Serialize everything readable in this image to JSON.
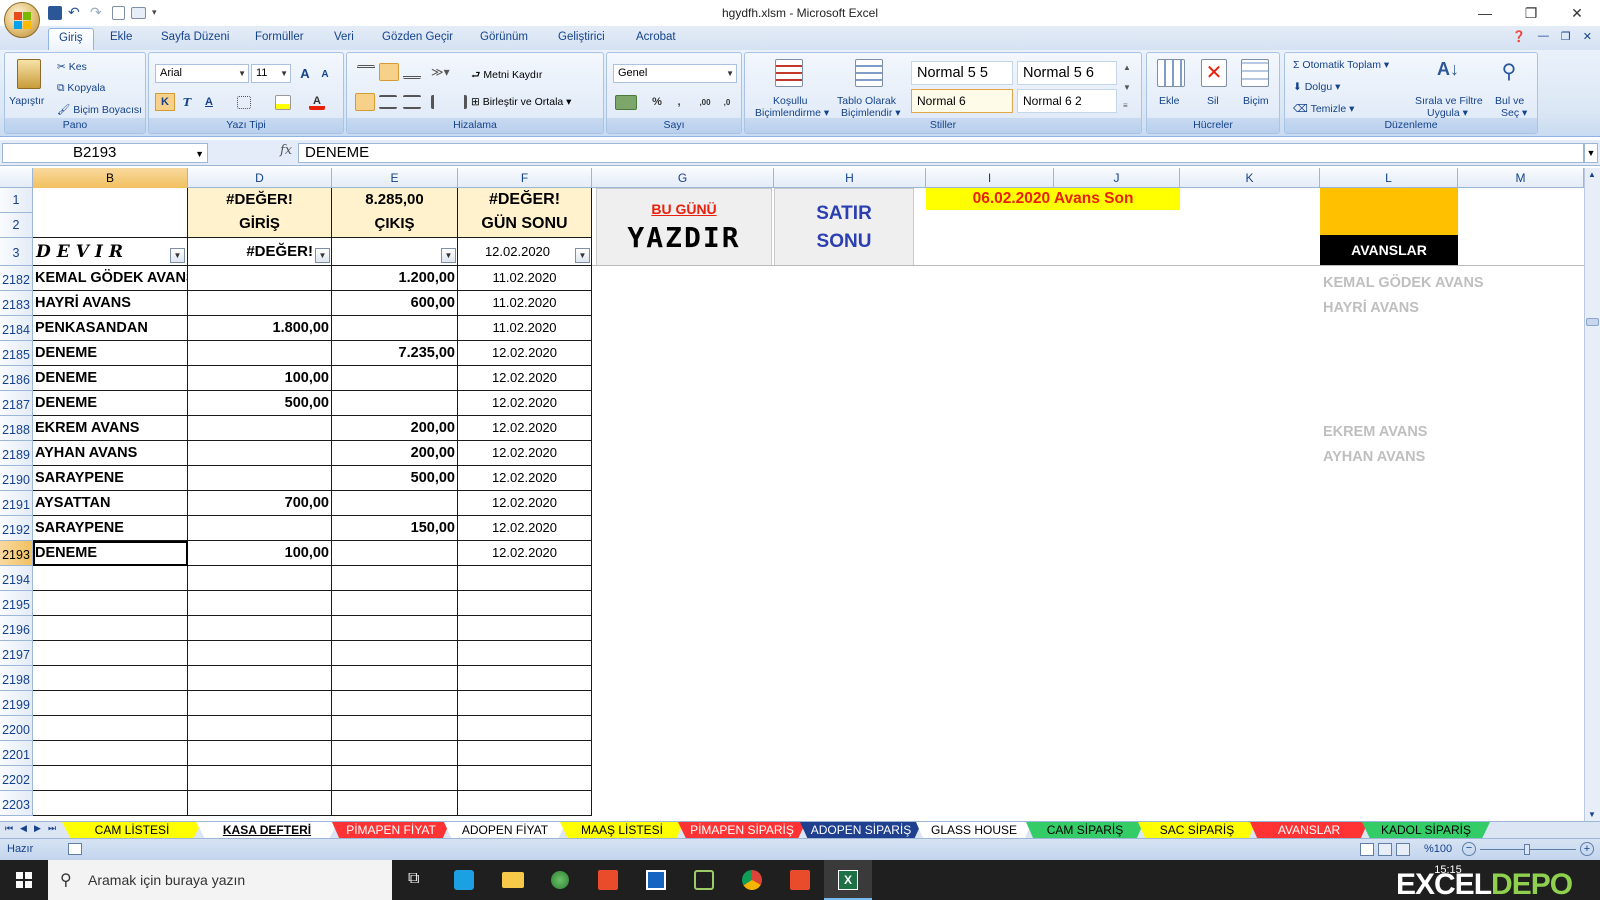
{
  "window": {
    "title": "hgydfh.xlsm - Microsoft Excel",
    "minimize": "—",
    "restore": "❐",
    "close": "✕"
  },
  "ribbon_tabs": [
    "Giriş",
    "Ekle",
    "Sayfa Düzeni",
    "Formüller",
    "Veri",
    "Gözden Geçir",
    "Görünüm",
    "Geliştirici",
    "Acrobat"
  ],
  "ribbon": {
    "pano": {
      "label": "Pano",
      "paste": "Yapıştır",
      "cut": "Kes",
      "copy": "Kopyala",
      "format_painter": "Biçim Boyacısı"
    },
    "font": {
      "label": "Yazı Tipi",
      "name": "Arial",
      "size": "11",
      "bold": "K",
      "italic": "T",
      "underline": "A"
    },
    "alignment": {
      "label": "Hizalama",
      "wrap": "Metni Kaydır",
      "merge": "Birleştir ve Ortala"
    },
    "number": {
      "label": "Sayı",
      "format": "Genel",
      "percent": "%",
      "comma": ","
    },
    "styles": {
      "label": "Stiller",
      "conditional": "Koşullu",
      "conditional2": "Biçimlendirme",
      "table": "Tablo Olarak",
      "table2": "Biçimlendir",
      "cells": [
        "Normal 5 5",
        "Normal 5 6",
        "Normal 6",
        "Normal 6 2"
      ]
    },
    "cells": {
      "label": "Hücreler",
      "insert": "Ekle",
      "delete": "Sil",
      "format": "Biçim"
    },
    "editing": {
      "label": "Düzenleme",
      "autosum": "Otomatik Toplam",
      "fill": "Dolgu",
      "clear": "Temizle",
      "sort": "Sırala ve Filtre",
      "sort2": "Uygula",
      "find": "Bul ve",
      "find2": "Seç"
    }
  },
  "formula_bar": {
    "name_box": "B2193",
    "fx": "fx",
    "value": "DENEME"
  },
  "columns": [
    "B",
    "D",
    "E",
    "F",
    "G",
    "H",
    "I",
    "J",
    "K",
    "L",
    "M"
  ],
  "header_rows": [
    "1",
    "2",
    "3"
  ],
  "header_cells": {
    "d1": "#DEĞER!",
    "d2": "GİRİŞ",
    "e1": "8.285,00",
    "e2": "ÇIKIŞ",
    "f1": "#DEĞER!",
    "f2": "GÜN SONU",
    "b3": "DEVIR",
    "d3": "#DEĞER!",
    "f3": "12.02.2020"
  },
  "buttons": {
    "bu_gunu": "BU GÜNÜ",
    "yazdir": "YAZDIR",
    "satir": "SATIR",
    "sonu": "SONU"
  },
  "avans_son": "06.02.2020  Avans Son",
  "avanslar": "AVANSLAR",
  "rows": [
    {
      "num": "2182",
      "b": "KEMAL GÖDEK AVANS",
      "d": "",
      "e": "1.200,00",
      "f": "11.02.2020"
    },
    {
      "num": "2183",
      "b": "HAYRİ AVANS",
      "d": "",
      "e": "600,00",
      "f": "11.02.2020"
    },
    {
      "num": "2184",
      "b": "PENKASANDAN",
      "d": "1.800,00",
      "e": "",
      "f": "11.02.2020"
    },
    {
      "num": "2185",
      "b": "DENEME",
      "d": "",
      "e": "7.235,00",
      "f": "12.02.2020"
    },
    {
      "num": "2186",
      "b": "DENEME",
      "d": "100,00",
      "e": "",
      "f": "12.02.2020"
    },
    {
      "num": "2187",
      "b": "DENEME",
      "d": "500,00",
      "e": "",
      "f": "12.02.2020"
    },
    {
      "num": "2188",
      "b": "EKREM AVANS",
      "d": "",
      "e": "200,00",
      "f": "12.02.2020"
    },
    {
      "num": "2189",
      "b": "AYHAN AVANS",
      "d": "",
      "e": "200,00",
      "f": "12.02.2020"
    },
    {
      "num": "2190",
      "b": "SARAYPENE",
      "d": "",
      "e": "500,00",
      "f": "12.02.2020"
    },
    {
      "num": "2191",
      "b": "AYSATTAN",
      "d": "700,00",
      "e": "",
      "f": "12.02.2020"
    },
    {
      "num": "2192",
      "b": "SARAYPENE",
      "d": "",
      "e": "150,00",
      "f": "12.02.2020"
    },
    {
      "num": "2193",
      "b": "DENEME",
      "d": "100,00",
      "e": "",
      "f": "12.02.2020"
    }
  ],
  "empty_rows": [
    "2194",
    "2195",
    "2196",
    "2197",
    "2198",
    "2199",
    "2200",
    "2201",
    "2202",
    "2203"
  ],
  "ghost_list": [
    "KEMAL GÖDEK AVANS",
    "HAYRİ AVANS",
    "EKREM AVANS",
    "AYHAN AVANS"
  ],
  "sheet_tabs": [
    {
      "label": "CAM LİSTESİ",
      "color": "#ffff00",
      "text": "#000000"
    },
    {
      "label": "KASA DEFTERİ",
      "color": "#ffffff",
      "text": "#000000"
    },
    {
      "label": "PİMAPEN FİYAT",
      "color": "#ff3333",
      "text": "#ffffff"
    },
    {
      "label": "ADOPEN FİYAT",
      "color": "#ffffff",
      "text": "#000000"
    },
    {
      "label": "MAAŞ LİSTESİ",
      "color": "#ffff00",
      "text": "#000000"
    },
    {
      "label": "PİMAPEN SİPARİŞ",
      "color": "#ff3333",
      "text": "#ffffff"
    },
    {
      "label": "ADOPEN SİPARİŞ",
      "color": "#1f3f8f",
      "text": "#ffffff"
    },
    {
      "label": "GLASS HOUSE",
      "color": "#ffffff",
      "text": "#000000"
    },
    {
      "label": "CAM SİPARİŞ",
      "color": "#33cc66",
      "text": "#000000"
    },
    {
      "label": "SAC SİPARİŞ",
      "color": "#ffff00",
      "text": "#000000"
    },
    {
      "label": "AVANSLAR",
      "color": "#ff3333",
      "text": "#ffffff"
    },
    {
      "label": "KADOL SİPARİŞ",
      "color": "#33cc66",
      "text": "#000000"
    }
  ],
  "status": {
    "text": "Hazır",
    "zoom": "%100"
  },
  "taskbar": {
    "search_placeholder": "Aramak için buraya yazın",
    "time": "15:15"
  },
  "watermark": {
    "a": "EXCEL",
    "b": "DEPO"
  }
}
